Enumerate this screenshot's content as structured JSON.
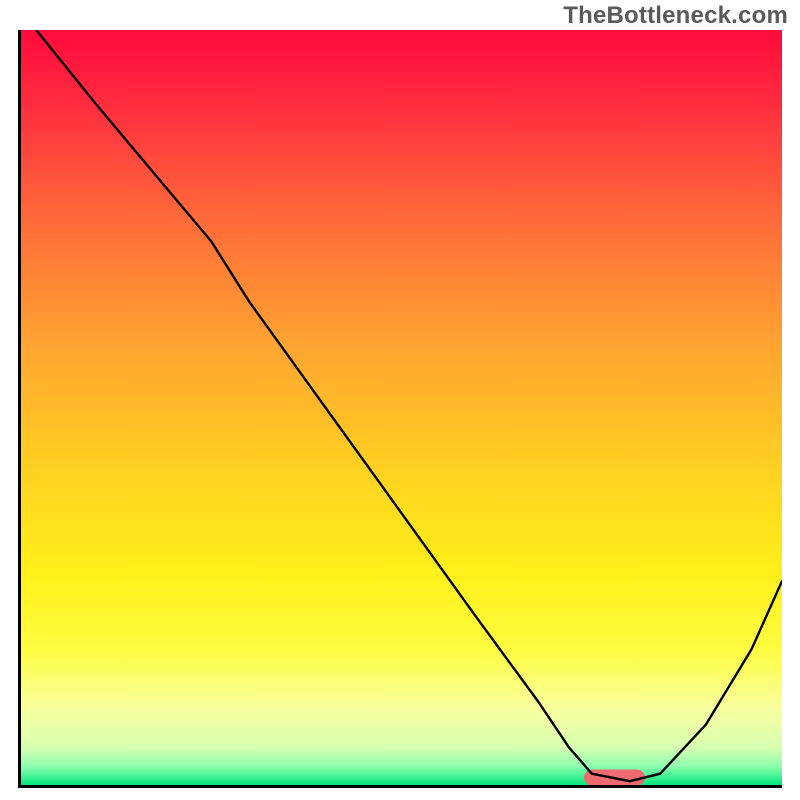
{
  "watermark": "TheBottleneck.com",
  "chart_data": {
    "type": "line",
    "title": "",
    "xlabel": "",
    "ylabel": "",
    "xlim": [
      0,
      100
    ],
    "ylim": [
      0,
      100
    ],
    "grid": false,
    "legend": false,
    "series": [
      {
        "name": "curve",
        "x": [
          2,
          10,
          20,
          25,
          30,
          40,
          50,
          60,
          68,
          72,
          75,
          80,
          84,
          90,
          96,
          100
        ],
        "y": [
          100,
          90,
          78,
          72,
          64,
          50,
          36,
          22,
          11,
          5,
          1.5,
          0.5,
          1.5,
          8,
          18,
          27
        ]
      }
    ],
    "background_gradient": {
      "stops": [
        {
          "pos": 0.0,
          "color": "#ff0a3c"
        },
        {
          "pos": 0.1,
          "color": "#ff2d3f"
        },
        {
          "pos": 0.25,
          "color": "#ff6a3a"
        },
        {
          "pos": 0.42,
          "color": "#ffa531"
        },
        {
          "pos": 0.58,
          "color": "#ffd021"
        },
        {
          "pos": 0.72,
          "color": "#fff01a"
        },
        {
          "pos": 0.82,
          "color": "#fffc40"
        },
        {
          "pos": 0.9,
          "color": "#f7ffa0"
        },
        {
          "pos": 0.95,
          "color": "#d8ffb0"
        },
        {
          "pos": 0.975,
          "color": "#8fffb0"
        },
        {
          "pos": 1.0,
          "color": "#00e87a"
        }
      ]
    },
    "marker": {
      "x_center": 78,
      "x_half_width": 4,
      "y": 1.0,
      "color": "#ee6a6f"
    }
  }
}
